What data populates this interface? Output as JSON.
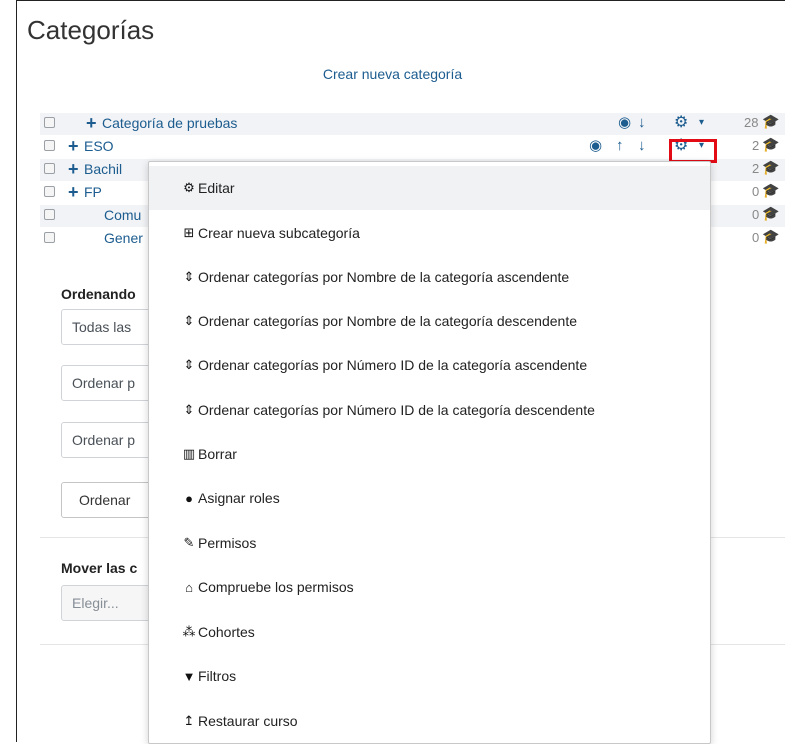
{
  "page": {
    "title": "Categorías",
    "create_link": "Crear nueva categoría"
  },
  "categories": [
    {
      "name": "Categoría de pruebas",
      "has_children": true,
      "count": "28"
    },
    {
      "name": "ESO",
      "has_children": true,
      "count": "2"
    },
    {
      "name": "Bachil",
      "has_children": true,
      "count": "2"
    },
    {
      "name": "FP",
      "has_children": true,
      "count": "0"
    },
    {
      "name": "Comu",
      "has_children": false,
      "count": "0"
    },
    {
      "name": "Gener",
      "has_children": false,
      "count": "0"
    }
  ],
  "sorting": {
    "label": "Ordenando",
    "select1": "Todas las",
    "select2": "Ordenar p",
    "select3": "Ordenar p",
    "button": "Ordenar"
  },
  "move": {
    "label": "Mover las c",
    "placeholder": "Elegir..."
  },
  "dropdown": {
    "items": [
      {
        "label": "Editar",
        "icon": "gear-icon"
      },
      {
        "label": "Crear nueva subcategoría",
        "icon": "plus-square-icon"
      },
      {
        "label": "Ordenar categorías por Nombre de la categoría ascendente",
        "icon": "sort-icon"
      },
      {
        "label": "Ordenar categorías por Nombre de la categoría descendente",
        "icon": "sort-icon"
      },
      {
        "label": "Ordenar categorías por Número ID de la categoría ascendente",
        "icon": "sort-icon"
      },
      {
        "label": "Ordenar categorías por Número ID de la categoría descendente",
        "icon": "sort-icon"
      },
      {
        "label": "Borrar",
        "icon": "trash-icon"
      },
      {
        "label": "Asignar roles",
        "icon": "user-icon"
      },
      {
        "label": "Permisos",
        "icon": "edit-icon"
      },
      {
        "label": "Compruebe los permisos",
        "icon": "unlock-icon"
      },
      {
        "label": "Cohortes",
        "icon": "users-icon"
      },
      {
        "label": "Filtros",
        "icon": "filter-icon"
      },
      {
        "label": "Restaurar curso",
        "icon": "restore-icon"
      }
    ]
  },
  "colors": {
    "link": "#1c5c8f",
    "highlight": "#e20b16"
  }
}
